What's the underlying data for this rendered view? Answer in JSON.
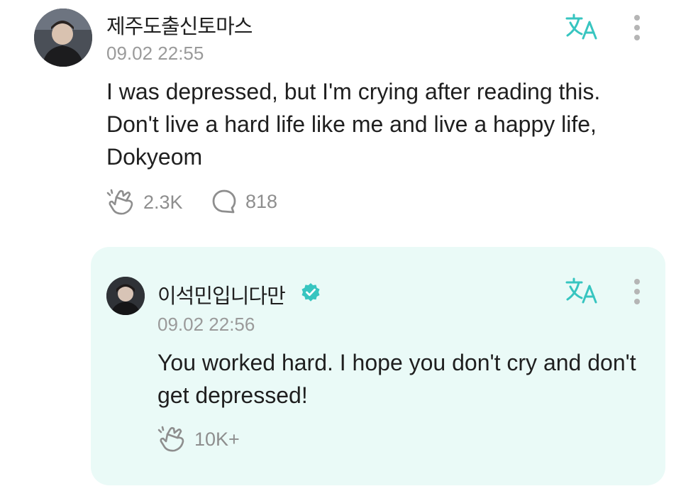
{
  "colors": {
    "accent": "#37c5c0",
    "reply_bg": "#eafaf7",
    "meta_gray": "#9a9a9a"
  },
  "comment": {
    "username": "제주도출신토마스",
    "timestamp": "09.02 22:55",
    "text": "I was depressed, but I'm crying after reading this. Don't live a hard life like me and live a happy life, Dokyeom",
    "likes": "2.3K",
    "replies": "818",
    "translate_icon": "translate-icon",
    "more_icon": "vertical-dots-icon"
  },
  "reply": {
    "username": "이석민입니다만",
    "verified": true,
    "timestamp": "09.02 22:56",
    "text": "You worked hard. I hope you don't cry and don't get depressed!",
    "likes": "10K+",
    "translate_icon": "translate-icon",
    "more_icon": "vertical-dots-icon"
  }
}
